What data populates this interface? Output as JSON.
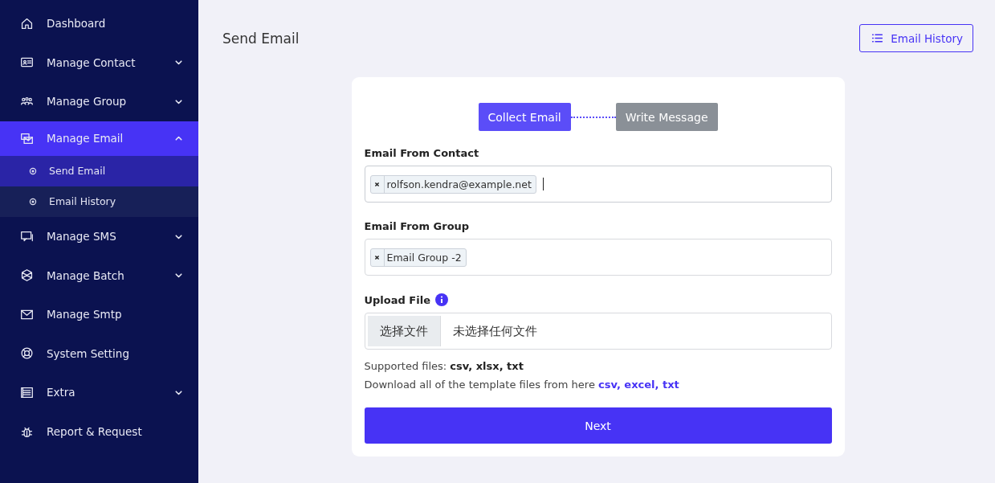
{
  "sidebar": {
    "items": [
      {
        "label": "Dashboard",
        "selected": false
      },
      {
        "label": "Manage Contact",
        "selected": false,
        "expanded": false
      },
      {
        "label": "Manage Group",
        "selected": false,
        "expanded": false
      },
      {
        "label": "Manage Email",
        "selected": true,
        "expanded": true,
        "children": [
          {
            "label": "Send Email",
            "selected": true
          },
          {
            "label": "Email History",
            "selected": false
          }
        ]
      },
      {
        "label": "Manage SMS",
        "selected": false,
        "expanded": false
      },
      {
        "label": "Manage Batch",
        "selected": false,
        "expanded": false
      },
      {
        "label": "Manage Smtp",
        "selected": false
      },
      {
        "label": "System Setting",
        "selected": false
      },
      {
        "label": "Extra",
        "selected": false,
        "expanded": false
      },
      {
        "label": "Report & Request",
        "selected": false
      }
    ]
  },
  "page": {
    "title": "Send Email",
    "history_button": "Email History"
  },
  "steps": [
    {
      "label": "Collect Email",
      "selected": true
    },
    {
      "label": "Write Message",
      "selected": false
    }
  ],
  "fields": [
    {
      "label": "Email From Contact",
      "tags": [
        "rolfson.kendra@example.net"
      ],
      "focused": true
    },
    {
      "label": "Email From Group",
      "tags": [
        "Email Group -2"
      ],
      "focused": false
    }
  ],
  "upload": {
    "label": "Upload File",
    "choose_button": "选择文件",
    "file_status": "未选择任何文件"
  },
  "supported": "Supported files: **csv, xlsx, txt**",
  "download": {
    "text": "Download all of the template files from here",
    "links": "csv, excel, txt"
  },
  "next_button": "Next"
}
